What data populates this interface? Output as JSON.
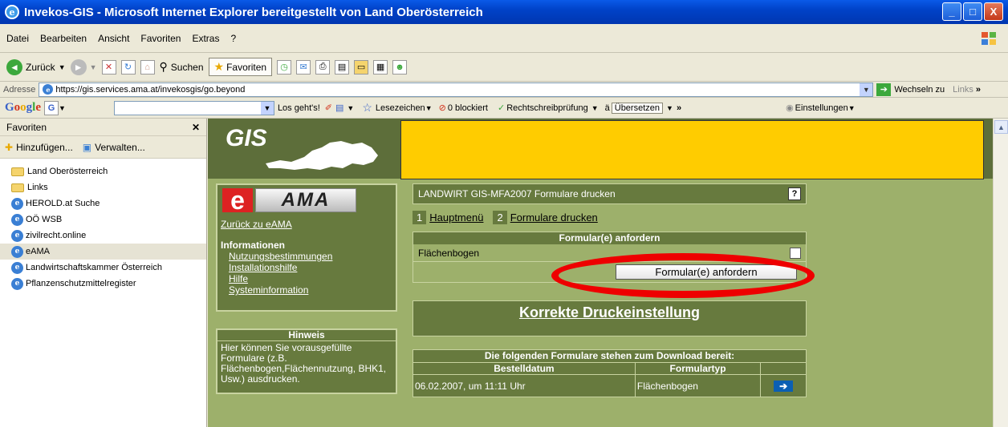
{
  "window": {
    "title": "Invekos-GIS - Microsoft Internet Explorer bereitgestellt von Land Oberösterreich",
    "minimize": "_",
    "maximize": "□",
    "close": "X"
  },
  "menu": [
    "Datei",
    "Bearbeiten",
    "Ansicht",
    "Favoriten",
    "Extras",
    "?"
  ],
  "toolbar": {
    "back": "Zurück",
    "search": "Suchen",
    "favorites": "Favoriten"
  },
  "address": {
    "label": "Adresse",
    "url": "https://gis.services.ama.at/invekosgis/go.beyond",
    "go": "Wechseln zu",
    "links": "Links"
  },
  "googlebar": {
    "logo": "Google",
    "go": "Los geht's!",
    "bookmarks": "Lesezeichen",
    "blocked": "0 blockiert",
    "spell": "Rechtschreibprüfung",
    "translate": "Übersetzen",
    "settings": "Einstellungen"
  },
  "sidebar": {
    "title": "Favoriten",
    "add": "Hinzufügen...",
    "manage": "Verwalten...",
    "items": [
      {
        "label": "Land Oberösterreich",
        "type": "folder"
      },
      {
        "label": "Links",
        "type": "folder"
      },
      {
        "label": "HEROLD.at Suche",
        "type": "page"
      },
      {
        "label": "OÖ WSB",
        "type": "page"
      },
      {
        "label": "zivilrecht.online",
        "type": "page"
      },
      {
        "label": "eAMA",
        "type": "page",
        "selected": true
      },
      {
        "label": "Landwirtschaftskammer Österreich",
        "type": "page"
      },
      {
        "label": "Pflanzenschutzmittelregister",
        "type": "page"
      }
    ]
  },
  "page": {
    "gis_logo": "GIS",
    "ama": {
      "e": "e",
      "logo_text": "AMA",
      "back_link": "Zurück zu eAMA",
      "info_title": "Informationen",
      "links": [
        "Nutzungsbestimmungen",
        "Installationshilfe",
        "Hilfe",
        "Systeminformation"
      ]
    },
    "hinweis": {
      "title": "Hinweis",
      "text": "Hier können Sie vorausgefüllte Formulare (z.B. Flächenbogen,Flächennutzung, BHK1, Usw.) ausdrucken."
    },
    "main_title": "LANDWIRT GIS-MFA2007 Formulare drucken",
    "help": "?",
    "steps": [
      {
        "num": "1",
        "label": "Hauptmenü"
      },
      {
        "num": "2",
        "label": "Formulare drucken"
      }
    ],
    "form": {
      "header": "Formular(e) anfordern",
      "row_label": "Flächenbogen",
      "button": "Formular(e) anfordern"
    },
    "print_link": "Korrekte Druckeinstellung",
    "downloads": {
      "header": "Die folgenden Formulare stehen zum Download bereit:",
      "col_date": "Bestelldatum",
      "col_type": "Formulartyp",
      "rows": [
        {
          "date": "06.02.2007, um 11:11 Uhr",
          "type": "Flächenbogen"
        }
      ]
    }
  }
}
